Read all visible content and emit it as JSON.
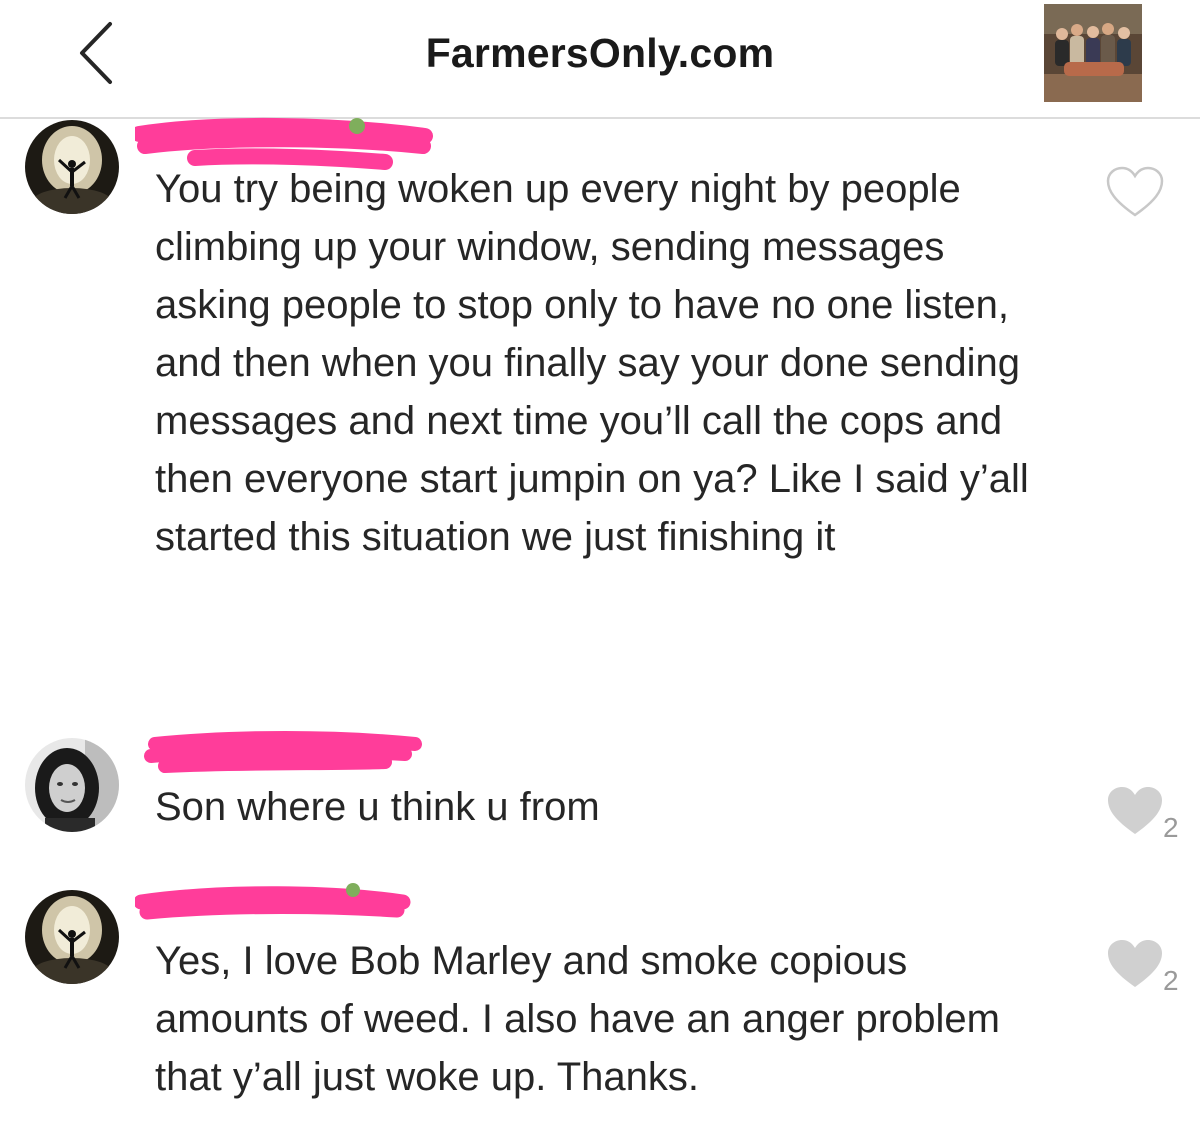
{
  "header": {
    "title": "FarmersOnly.com",
    "back_icon": "chevron-left-icon",
    "thumbnail": "group-photo-thumbnail"
  },
  "comments": [
    {
      "avatar": "performer-on-stage-avatar",
      "username_redacted": true,
      "text": "You try being woken up every night by people climbing up your window, sending messages asking people to stop only to have no one listen, and then when you finally say your done sending messages and next time you’ll call the cops and then everyone start jumpin on ya? Like I said y’all started this situation we just finishing it",
      "liked": false,
      "like_count": ""
    },
    {
      "avatar": "woman-portrait-avatar",
      "username_redacted": true,
      "text": "Son where u think u from",
      "liked": true,
      "like_count": "2"
    },
    {
      "avatar": "performer-on-stage-avatar",
      "username_redacted": true,
      "text": "Yes, I love Bob Marley and  smoke copious amounts of weed. I also have an anger problem that y’all just woke up. Thanks.",
      "liked": true,
      "like_count": "2"
    }
  ],
  "colors": {
    "redaction": "#ff3d9a",
    "text": "#262626",
    "like_filled": "#d0d0d0",
    "like_outline": "#c8c8c8",
    "divider": "#dcdcdc"
  }
}
